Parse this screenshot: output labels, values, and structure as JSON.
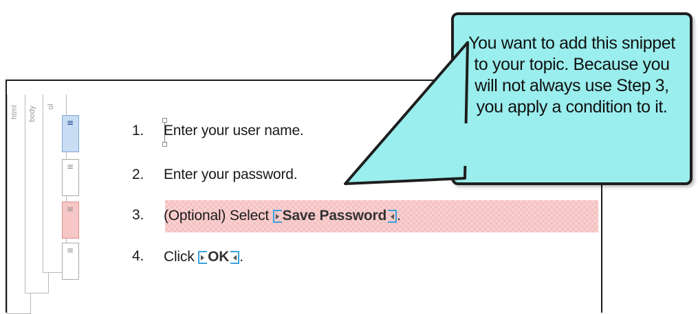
{
  "structure_bars": {
    "html": "html",
    "body": "body",
    "ol": "ol",
    "li_glyph": "≡"
  },
  "steps": [
    {
      "num": "1.",
      "text": "Enter your user name."
    },
    {
      "num": "2.",
      "text": "Enter your password."
    },
    {
      "num": "3.",
      "prefix": "(Optional) Select ",
      "ui_text": "Save Password",
      "suffix": "."
    },
    {
      "num": "4.",
      "prefix": "Click ",
      "ui_text": "OK",
      "suffix": "."
    }
  ],
  "callout": {
    "text": "You want to add this snippet to your topic. Because you will not always use Step 3, you apply a condition to it."
  },
  "colors": {
    "callout_fill": "#9aeeed",
    "condition_highlight": "#f6c1c1",
    "tag_marker": "#3aa0dc",
    "selected_block": "#c8dcf4"
  }
}
